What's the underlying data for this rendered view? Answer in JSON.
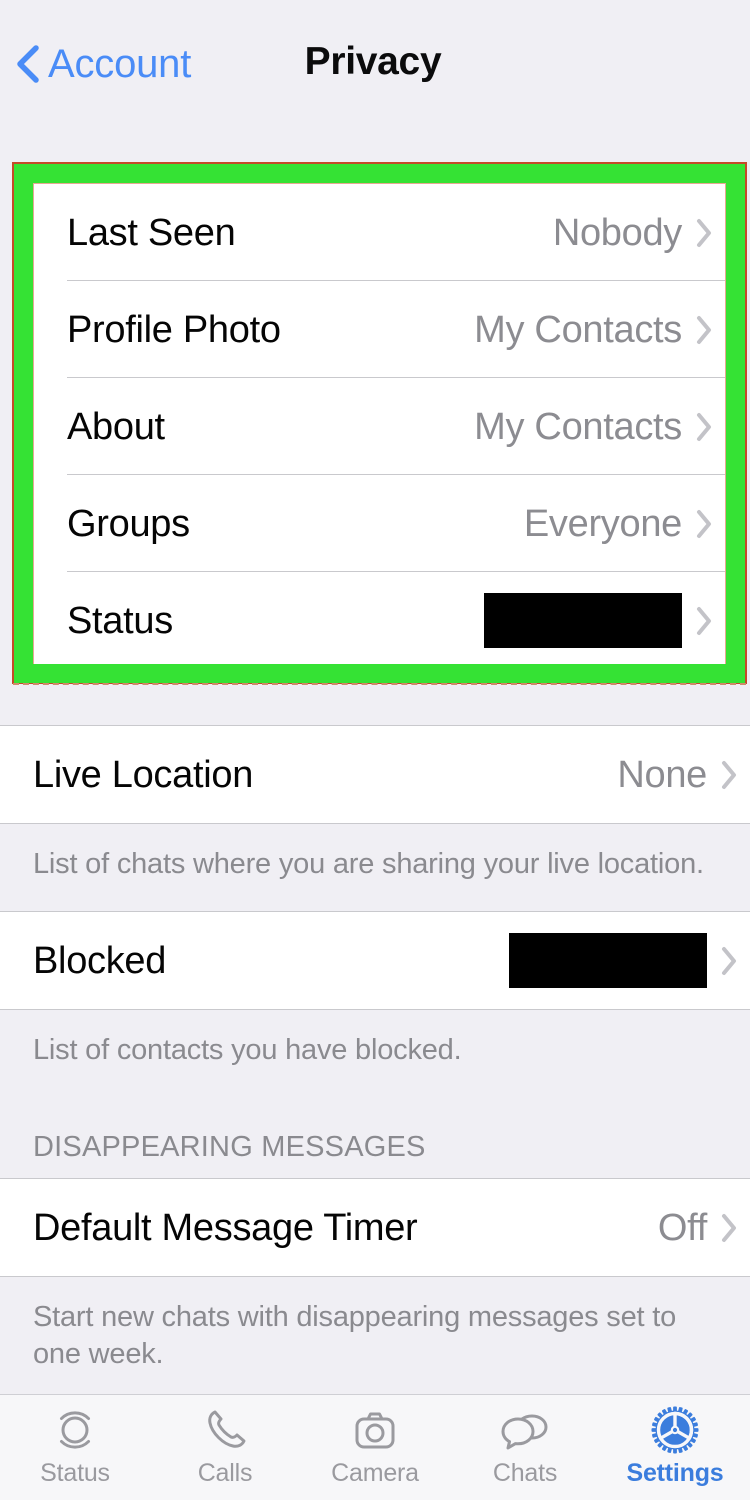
{
  "nav": {
    "back_label": "Account",
    "back_icon": "chevron-left-icon",
    "title": "Privacy"
  },
  "highlight": {
    "border_color": "#35e234",
    "outline_color": "#c34a28"
  },
  "privacy_group": {
    "rows": [
      {
        "label": "Last Seen",
        "value": "Nobody",
        "redacted": false
      },
      {
        "label": "Profile Photo",
        "value": "My Contacts",
        "redacted": false
      },
      {
        "label": "About",
        "value": "My Contacts",
        "redacted": false
      },
      {
        "label": "Groups",
        "value": "Everyone",
        "redacted": false
      },
      {
        "label": "Status",
        "value": "",
        "redacted": true
      }
    ]
  },
  "live_location": {
    "label": "Live Location",
    "value": "None",
    "footer": "List of chats where you are sharing your live location."
  },
  "blocked": {
    "label": "Blocked",
    "value": "",
    "redacted": true,
    "footer": "List of contacts you have blocked."
  },
  "disappearing": {
    "section_header": "DISAPPEARING MESSAGES",
    "label": "Default Message Timer",
    "value": "Off",
    "footer": "Start new chats with disappearing messages set to one week."
  },
  "tab_bar": {
    "items": [
      {
        "label": "Status",
        "icon": "status-rings-icon",
        "active": false
      },
      {
        "label": "Calls",
        "icon": "phone-icon",
        "active": false
      },
      {
        "label": "Camera",
        "icon": "camera-icon",
        "active": false
      },
      {
        "label": "Chats",
        "icon": "chat-bubbles-icon",
        "active": false
      },
      {
        "label": "Settings",
        "icon": "gear-icon",
        "active": true
      }
    ],
    "active_color": "#3b7ddd",
    "inactive_color": "#9a9a9f"
  }
}
